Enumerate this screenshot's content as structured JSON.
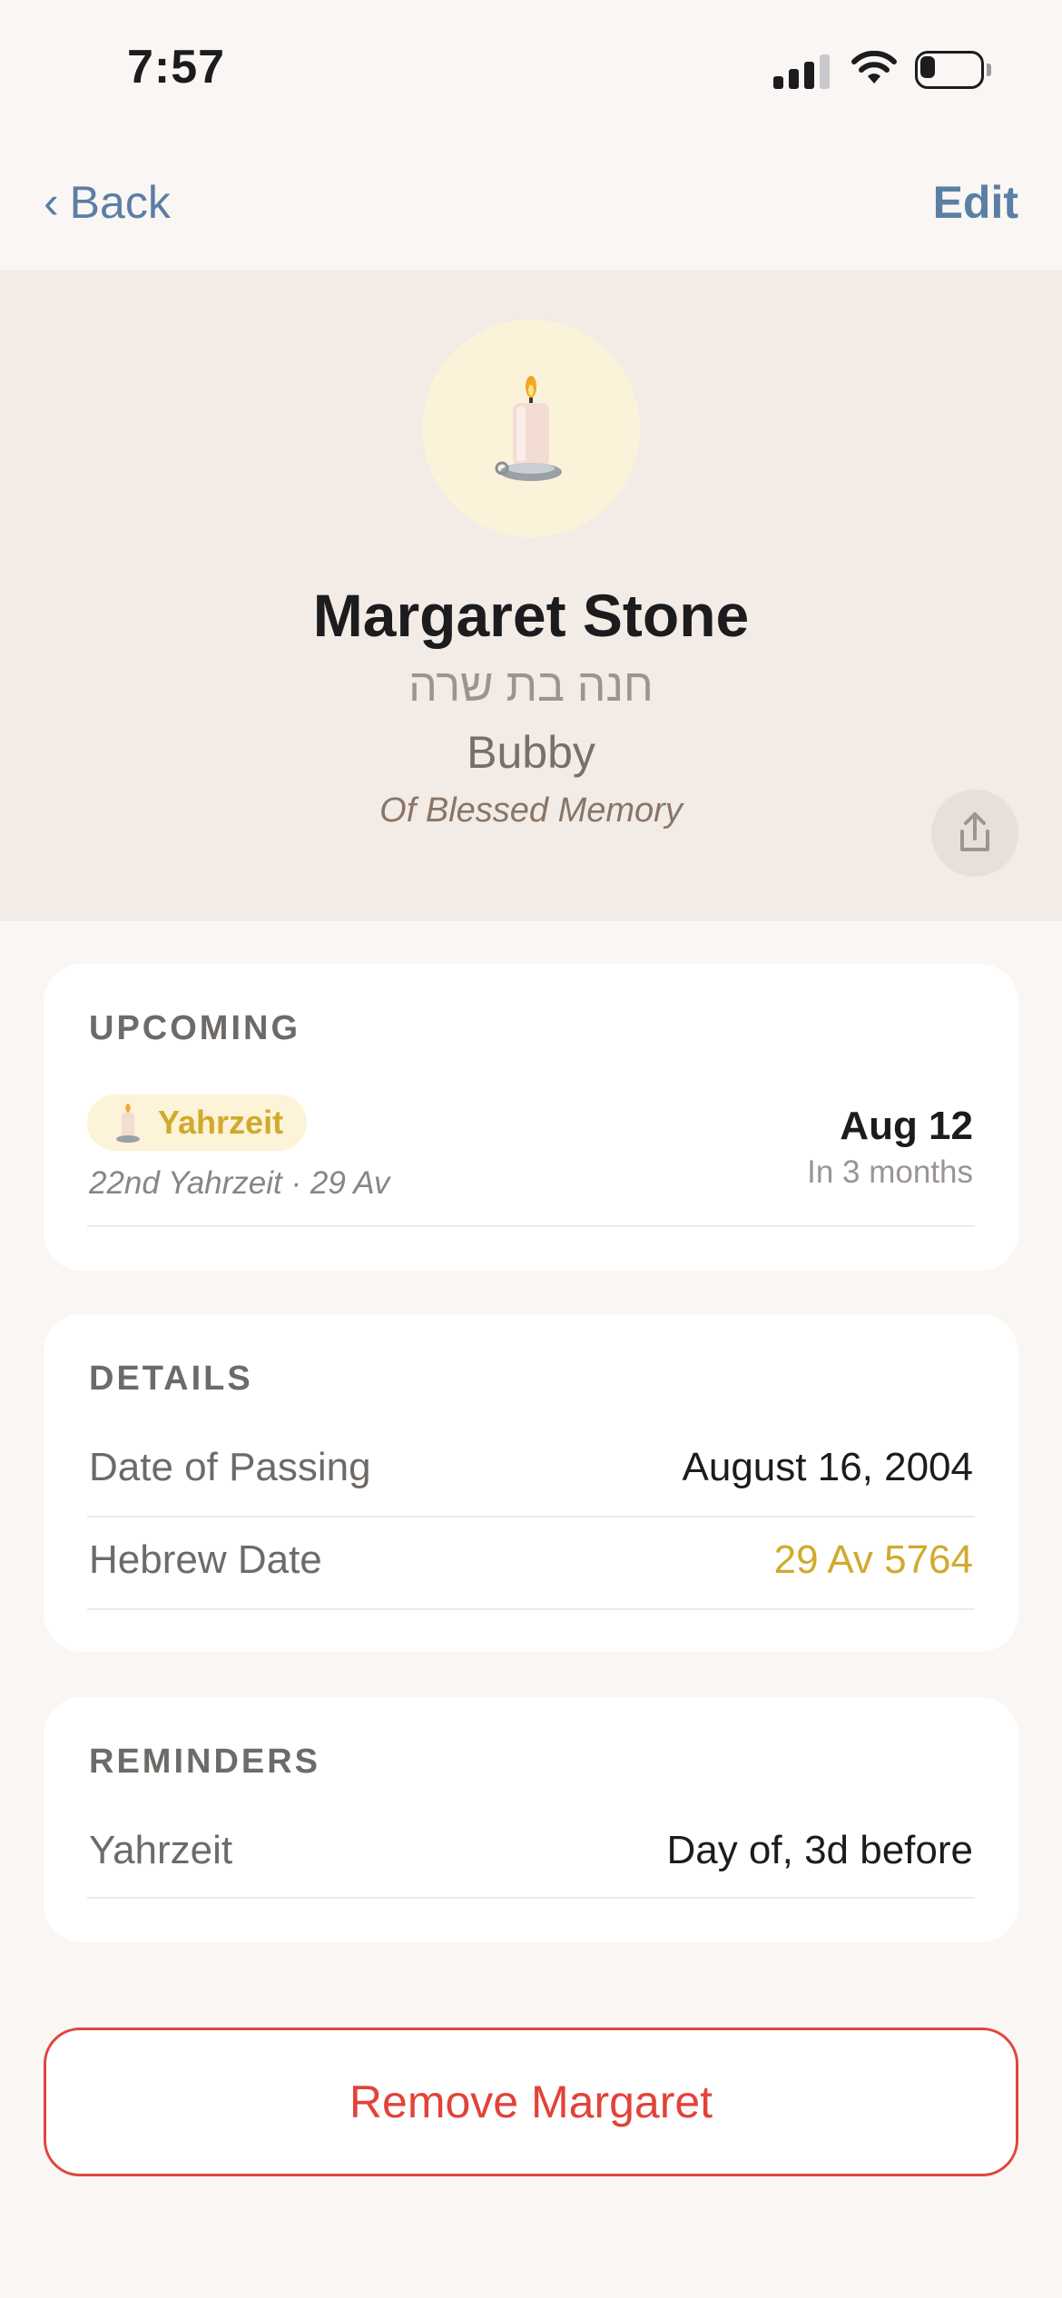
{
  "status_bar": {
    "time": "7:57",
    "icons": [
      "cellular-signal-icon",
      "wifi-icon",
      "battery-icon"
    ]
  },
  "nav": {
    "back_label": "Back",
    "edit_label": "Edit"
  },
  "profile": {
    "name": "Margaret Stone",
    "hebrew_name": "חנה בת שרה",
    "nickname": "Bubby",
    "memorial": "Of Blessed Memory",
    "avatar_icon": "candle-icon",
    "share_icon": "share-icon"
  },
  "upcoming": {
    "title": "UPCOMING",
    "pill_label": "Yahrzeit",
    "subtitle": "22nd Yahrzeit · 29 Av",
    "date": "Aug 12",
    "relative": "In 3 months"
  },
  "details": {
    "title": "DETAILS",
    "rows": [
      {
        "label": "Date of Passing",
        "value": "August 16, 2004"
      },
      {
        "label": "Hebrew Date",
        "value": "29 Av 5764"
      }
    ]
  },
  "reminders": {
    "title": "REMINDERS",
    "rows": [
      {
        "label": "Yahrzeit",
        "value": "Day of, 3d before"
      }
    ]
  },
  "remove_button": {
    "label": "Remove Margaret"
  },
  "colors": {
    "accent_blue": "#5a7fa6",
    "gold": "#d1aa2c",
    "danger_red": "#e24338",
    "header_bg": "#f2ebe6",
    "page_bg": "#f9f6f3"
  }
}
